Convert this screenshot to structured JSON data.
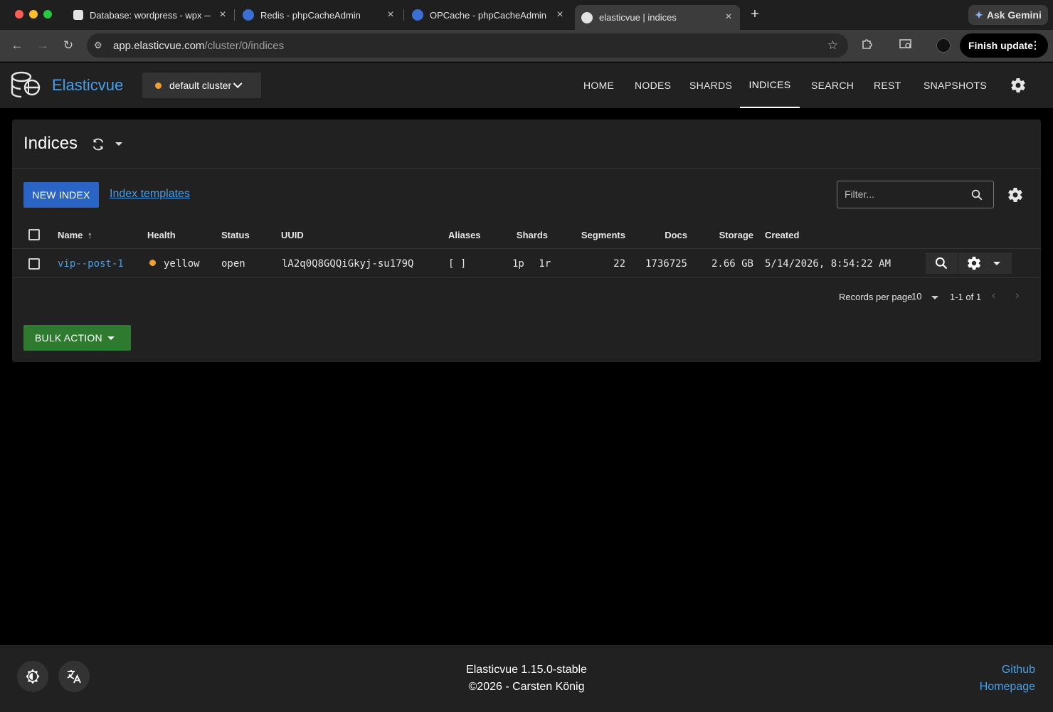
{
  "browser": {
    "tabs": [
      {
        "title": "Database: wordpress - wpx —",
        "active": false
      },
      {
        "title": "Redis - phpCacheAdmin",
        "active": false
      },
      {
        "title": "OPCache - phpCacheAdmin",
        "active": false
      },
      {
        "title": "elasticvue | indices",
        "active": true
      }
    ],
    "gemini_label": "Ask Gemini",
    "url_host": "app.elasticvue.com",
    "url_path": "/cluster/0/indices",
    "update_label": "Finish update"
  },
  "app": {
    "brand": "Elasticvue",
    "cluster": {
      "name": "default cluster",
      "status_color": "#f0a030"
    },
    "nav": [
      {
        "label": "HOME"
      },
      {
        "label": "NODES"
      },
      {
        "label": "SHARDS"
      },
      {
        "label": "INDICES",
        "active": true
      },
      {
        "label": "SEARCH"
      },
      {
        "label": "REST"
      },
      {
        "label": "SNAPSHOTS"
      }
    ]
  },
  "indices": {
    "title": "Indices",
    "new_index_label": "NEW INDEX",
    "templates_link": "Index templates",
    "filter_placeholder": "Filter...",
    "columns": {
      "name": "Name",
      "sort_indicator": "↑",
      "health": "Health",
      "status": "Status",
      "uuid": "UUID",
      "aliases": "Aliases",
      "shards": "Shards",
      "segments": "Segments",
      "docs": "Docs",
      "storage": "Storage",
      "created": "Created"
    },
    "rows": [
      {
        "name": "vip--post-1",
        "health": "yellow",
        "health_color": "#f0a030",
        "status": "open",
        "uuid": "lA2q0Q8GQQiGkyj-su179Q",
        "aliases": "[ ]",
        "shards_primary": "1p",
        "shards_replica": "1r",
        "segments": "22",
        "docs": "1736725",
        "storage": "2.66 GB",
        "created": "5/14/2026, 8:54:22 AM"
      }
    ],
    "pagination": {
      "records_per_page_label": "Records per page",
      "records_per_page": "10",
      "range": "1-1 of 1"
    },
    "bulk_action_label": "BULK ACTION"
  },
  "footer": {
    "version": "Elasticvue 1.15.0-stable",
    "copyright": "©2026 - Carsten König",
    "links": [
      "Github",
      "Homepage"
    ]
  },
  "colors": {
    "accent": "#4a9ee8",
    "primary_button": "#2a64c5",
    "bulk_button": "#2e7a2f",
    "warning": "#f0a030"
  }
}
